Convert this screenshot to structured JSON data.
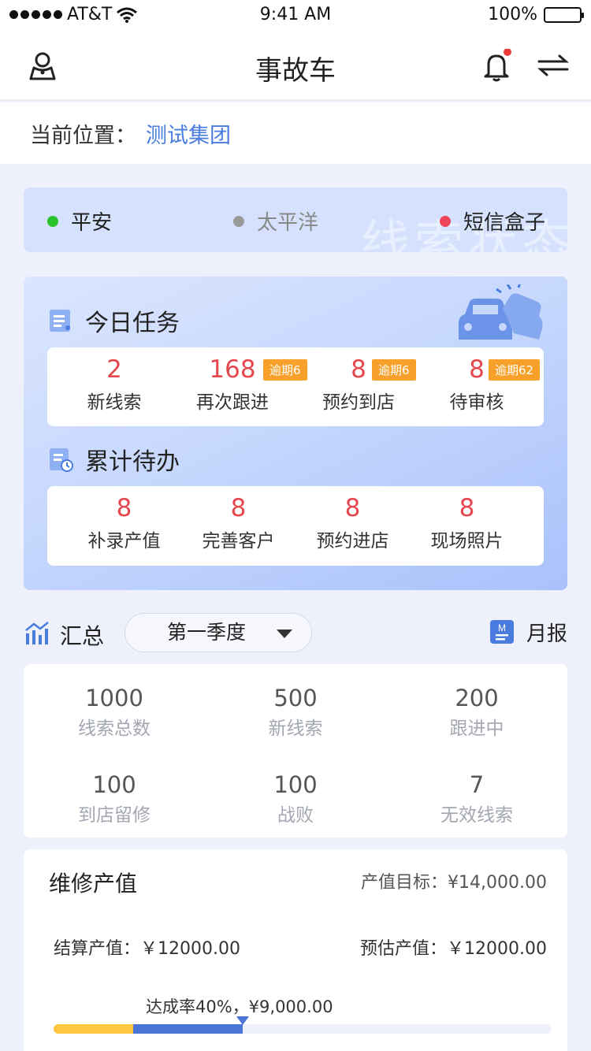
{
  "status_bar": {
    "carrier": "AT&T",
    "time": "9:41 AM",
    "battery": "100%"
  },
  "nav": {
    "title": "事故车"
  },
  "location": {
    "label": "当前位置：",
    "value": "测试集团"
  },
  "channels": {
    "watermark": "线索状态",
    "items": [
      {
        "label": "平安",
        "color": "#2ac22a"
      },
      {
        "label": "太平洋",
        "color": "#9a9a9a"
      },
      {
        "label": "短信盒子",
        "color": "#ee4458"
      }
    ]
  },
  "today": {
    "title": "今日任务",
    "items": [
      {
        "value": "2",
        "label": "新线索",
        "tag": ""
      },
      {
        "value": "168",
        "label": "再次跟进",
        "tag": "逾期6"
      },
      {
        "value": "8",
        "label": "预约到店",
        "tag": "逾期6"
      },
      {
        "value": "8",
        "label": "待审核",
        "tag": "逾期62"
      }
    ]
  },
  "pending": {
    "title": "累计待办",
    "items": [
      {
        "value": "8",
        "label": "补录产值"
      },
      {
        "value": "8",
        "label": "完善客户"
      },
      {
        "value": "8",
        "label": "预约进店"
      },
      {
        "value": "8",
        "label": "现场照片"
      }
    ]
  },
  "summary": {
    "title": "汇总",
    "period": "第一季度",
    "monthly": "月报",
    "monthly_icon_letter": "M",
    "stats": [
      {
        "value": "1000",
        "label": "线索总数"
      },
      {
        "value": "500",
        "label": "新线索"
      },
      {
        "value": "200",
        "label": "跟进中"
      },
      {
        "value": "100",
        "label": "到店留修"
      },
      {
        "value": "100",
        "label": "战败"
      },
      {
        "value": "7",
        "label": "无效线索"
      }
    ]
  },
  "revenue": {
    "title": "维修产值",
    "goal": "产值目标：¥14,000.00",
    "settled": "结算产值：￥12000.00",
    "estimated": "预估产值：￥12000.00",
    "rate": "达成率40%，¥9,000.00",
    "progress_yellow": 0.16,
    "progress_blue": 0.38
  },
  "colors": {
    "accent": "#4a7ce0",
    "danger": "#e5474d",
    "tag": "#f7a12b"
  }
}
